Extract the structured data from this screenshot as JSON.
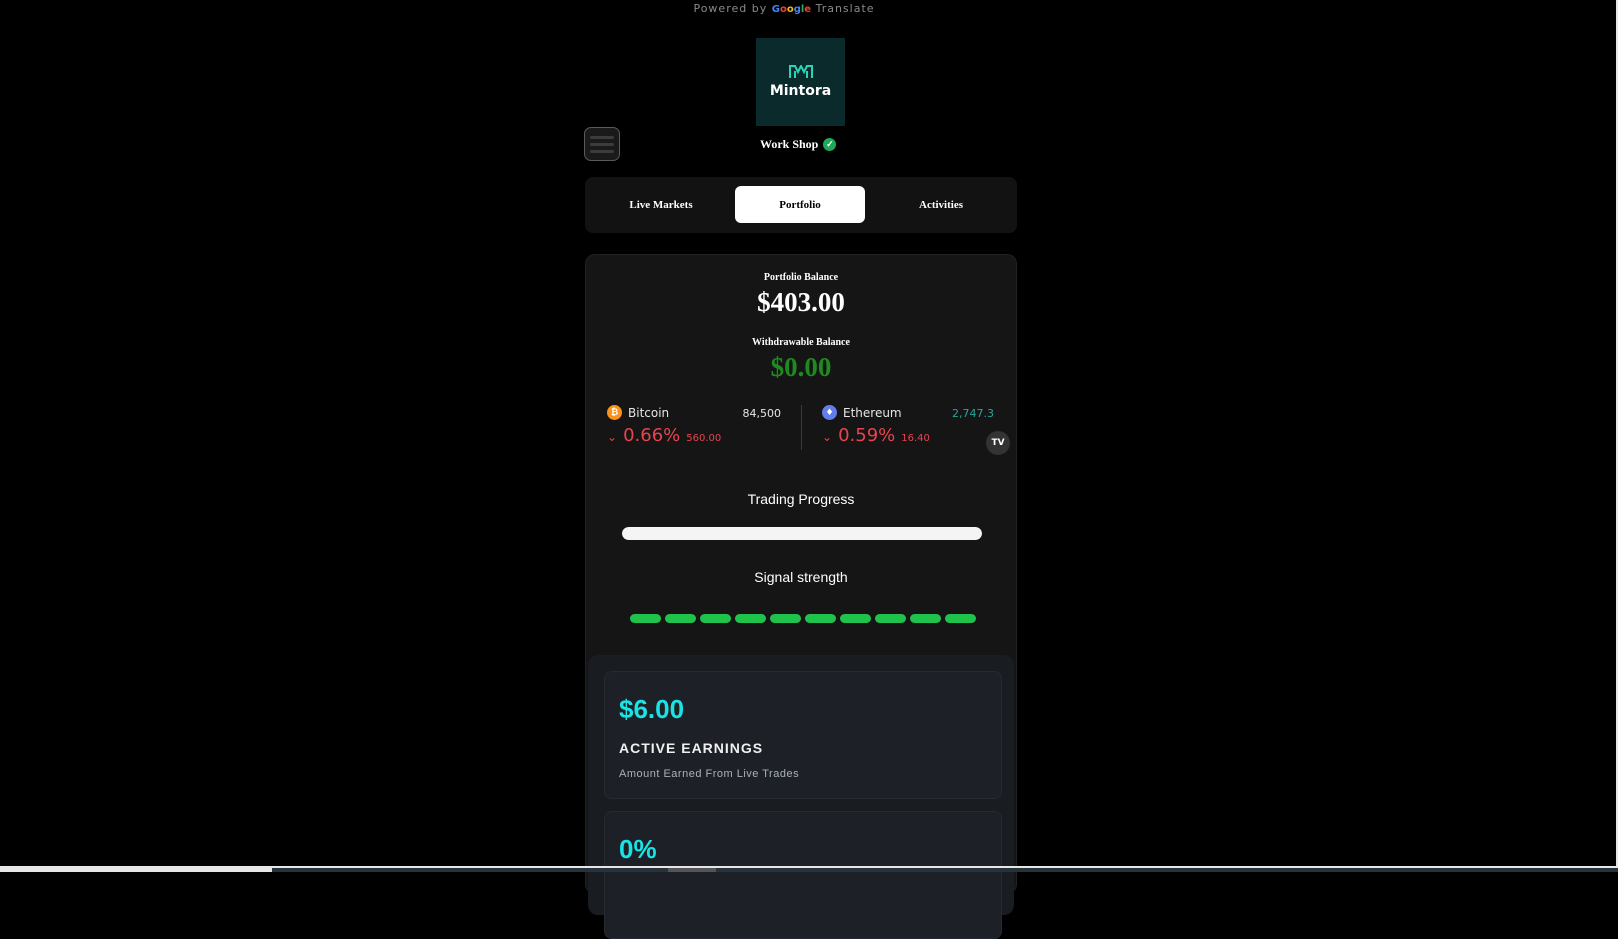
{
  "translate_bar": {
    "powered_by": "Powered by",
    "google": "Google",
    "translate": "Translate"
  },
  "brand": {
    "name": "Mintora",
    "logo_icon": "m-logo-icon",
    "accent": "#2bd4b4",
    "logo_bg": "#0b2a2c"
  },
  "menu": {
    "icon": "hamburger-icon"
  },
  "shop": {
    "name": "Work Shop",
    "verified_icon": "verified-check-icon",
    "verified_color": "#1fa85a"
  },
  "tabs": [
    {
      "label": "Live Markets",
      "active": false
    },
    {
      "label": "Portfolio",
      "active": true
    },
    {
      "label": "Activities",
      "active": false
    }
  ],
  "portfolio": {
    "balance_label": "Portfolio Balance",
    "balance_value": "$403.00",
    "withdrawable_label": "Withdrawable Balance",
    "withdrawable_value": "$0.00",
    "withdrawable_color": "#1f8a1f"
  },
  "ticker": {
    "coins": [
      {
        "name": "Bitcoin",
        "icon": "bitcoin-icon",
        "icon_color": "#f7931a",
        "price": "84,500",
        "price_color": "#e6e6e6",
        "change_pct": "0.66%",
        "change_abs": "560.00",
        "direction_icon": "chevron-down-icon"
      },
      {
        "name": "Ethereum",
        "icon": "ethereum-icon",
        "icon_color": "#627eea",
        "price": "2,747.3",
        "price_color": "#26a69a",
        "change_pct": "0.59%",
        "change_abs": "16.40",
        "direction_icon": "chevron-down-icon"
      }
    ],
    "negative_color": "#e8434f",
    "widget_badge": "tradingview-icon",
    "widget_badge_text": "TV"
  },
  "trading_progress": {
    "title": "Trading Progress",
    "percent": 100
  },
  "signal_strength": {
    "title": "Signal strength",
    "active_bars": 10,
    "total_bars": 10,
    "color": "#1fc24a"
  },
  "stats": [
    {
      "value": "$6.00",
      "title": "ACTIVE EARNINGS",
      "subtitle": "Amount Earned From Live Trades"
    },
    {
      "value": "0%",
      "title": "",
      "subtitle": ""
    }
  ],
  "stat_value_color": "#19e3e3"
}
